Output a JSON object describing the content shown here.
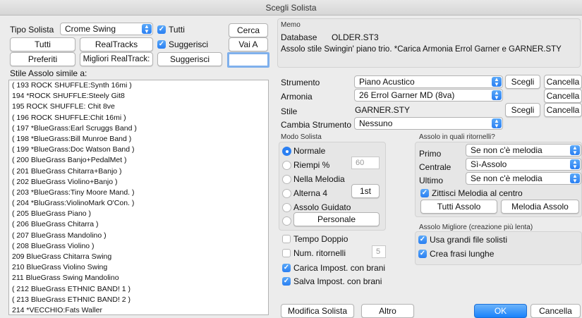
{
  "window": {
    "title": "Scegli Solista"
  },
  "left": {
    "tipo_label": "Tipo Solista",
    "tipo_value": "Crome Swing",
    "tutti_check_label": "Tutti",
    "cerca": "Cerca",
    "tutti_button": "Tutti",
    "realtracks": "RealTracks",
    "suggerisci_check_label": "Suggerisci",
    "vai_a": "Vai A",
    "preferiti": "Preferiti",
    "migliori": "Migliori RealTrack:",
    "suggerisci_button": "Suggerisci",
    "list_label": "Stile Assolo simile a:",
    "list_items": [
      "( 193 ROCK SHUFFLE:Synth 16mi )",
      "194 *ROCK SHUFFLE:Steely Git8",
      "195 ROCK SHUFFLE: Chit 8ve",
      "( 196 ROCK SHUFFLE:Chit 16mi )",
      "( 197 *BlueGrass:Earl Scruggs Band )",
      "( 198 *BlueGrass:Bill Munroe Band )",
      "( 199 *BlueGrass:Doc Watson Band )",
      "( 200 BlueGrass Banjo+PedalMet )",
      "( 201 BlueGrass Chitarra+Banjo )",
      "( 202 BlueGrass Violino+Banjo )",
      "( 203 *BlueGrass:Tiny Moore Mand. )",
      "( 204 *BluGrass:ViolinoMark O'Con. )",
      "( 205 BlueGrass Piano )",
      "( 206 BlueGrass Chitarra )",
      "( 207 BlueGrass Mandolino )",
      "( 208 BlueGrass Violino )",
      "209 BlueGrass Chitarra Swing",
      "210 BlueGrass Violino Swing",
      "211 BlueGrass Swing Mandolino",
      "( 212 BlueGrass ETHNIC BAND! 1 )",
      "( 213 BlueGrass ETHNIC BAND! 2 )",
      "214 *VECCHIO:Fats Waller"
    ]
  },
  "memo": {
    "label": "Memo",
    "database_label": "Database",
    "database_value": "OLDER.ST3",
    "text": "Assolo stile Swingin' piano trio. *Carica Armonia Errol Garner e GARNER.STY"
  },
  "settings": {
    "strumento_label": "Strumento",
    "strumento_value": "Piano Acustico",
    "armonia_label": "Armonia",
    "armonia_value": "26 Errol Garner MD (8va)",
    "stile_label": "Stile",
    "stile_value": "GARNER.STY",
    "cambia_label": "Cambia Strumento",
    "cambia_value": "Nessuno",
    "scegli": "Scegli",
    "cancella": "Cancella"
  },
  "modo": {
    "title": "Modo Solista",
    "normale": "Normale",
    "riempi": "Riempi %",
    "riempi_value": "60",
    "nella_melodia": "Nella Melodia",
    "alterna": "Alterna 4",
    "alterna_button": "1st",
    "guidato": "Assolo Guidato",
    "personale": "Personale"
  },
  "extra": {
    "tempo_doppio": "Tempo Doppio",
    "num_ritornelli": "Num. ritornelli",
    "num_value": "5",
    "carica": "Carica Impost. con brani",
    "salva": "Salva Impost. con brani"
  },
  "ritornelli": {
    "title": "Assolo in quali ritornelli?",
    "primo_label": "Primo",
    "primo_value": "Se non c'è melodia",
    "centrale_label": "Centrale",
    "centrale_value": "Sì-Assolo",
    "ultimo_label": "Ultimo",
    "ultimo_value": "Se non c'è melodia",
    "zittisci": "Zittisci Melodia al centro",
    "tutti_assolo": "Tutti Assolo",
    "melodia_assolo": "Melodia  Assolo"
  },
  "migliore": {
    "title": "Assolo Migliore (creazione più lenta)",
    "grandi": "Usa grandi file solisti",
    "frasi": "Crea frasi lunghe"
  },
  "footer": {
    "modifica": "Modifica Solista",
    "altro": "Altro",
    "ok": "OK",
    "cancella": "Cancella"
  }
}
